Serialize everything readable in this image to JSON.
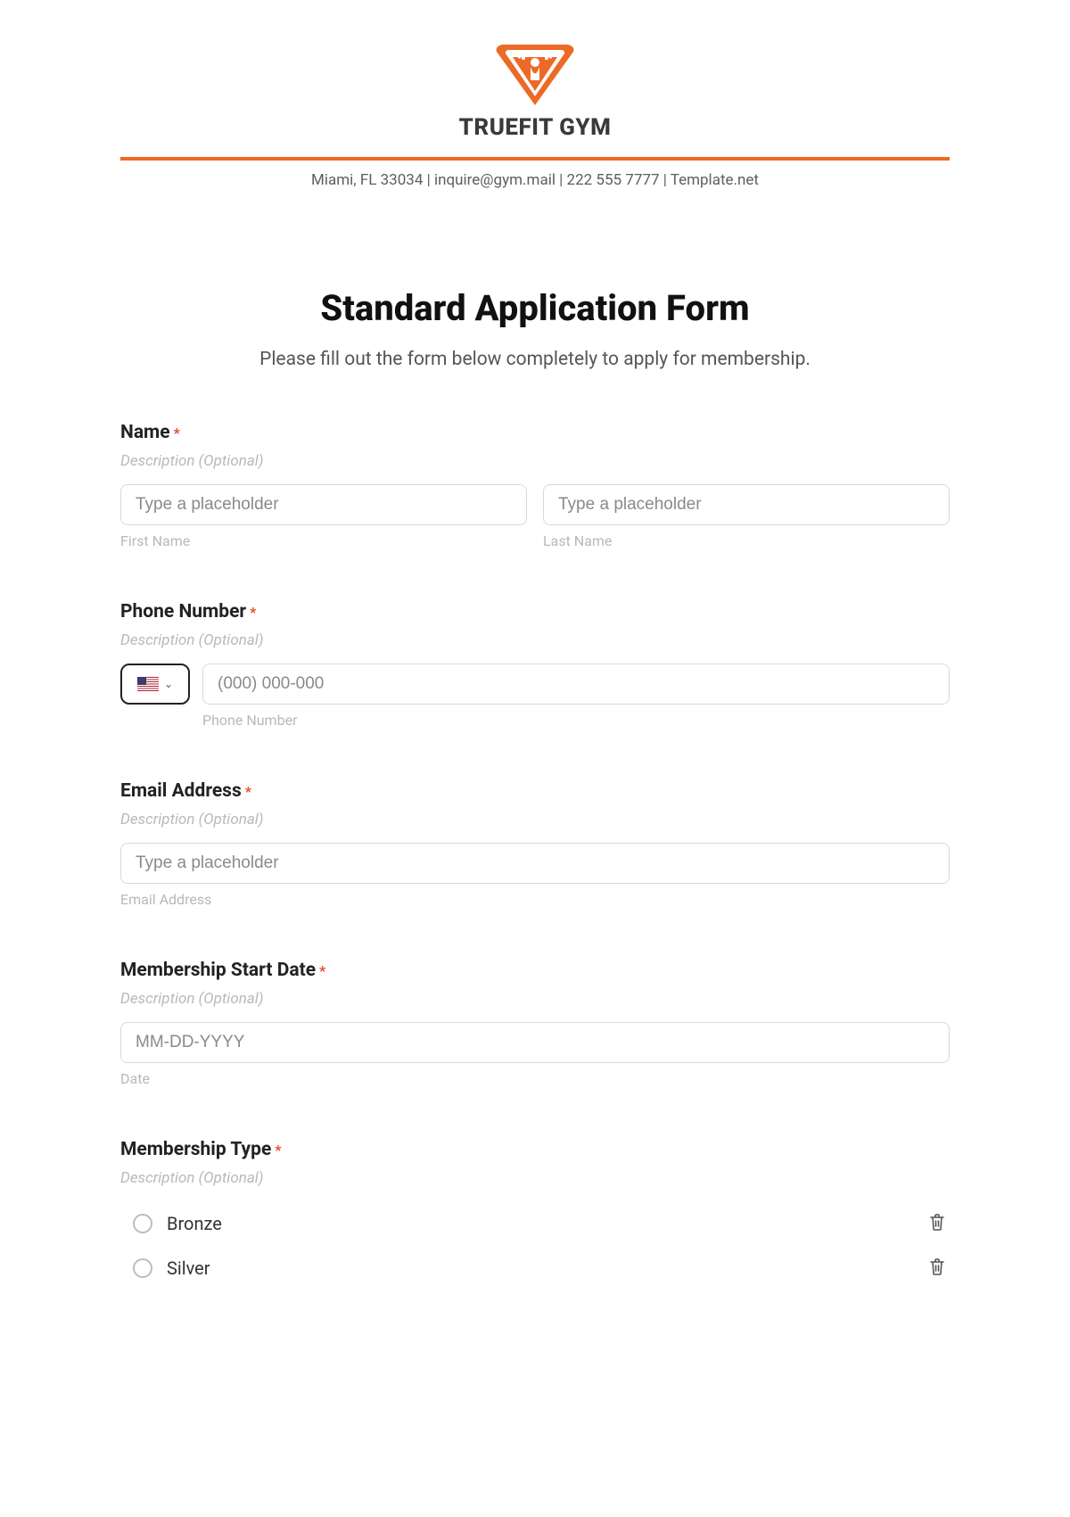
{
  "header": {
    "brand": "TRUEFIT GYM",
    "contact": "Miami, FL 33034 | inquire@gym.mail | 222 555 7777 | Template.net"
  },
  "page": {
    "title": "Standard Application Form",
    "subtitle": "Please fill out the form below completely to apply for membership."
  },
  "form": {
    "desc_placeholder": "Description (Optional)",
    "required_mark": "*",
    "name": {
      "label": "Name",
      "first_placeholder": "Type a placeholder",
      "first_sub": "First Name",
      "last_placeholder": "Type a placeholder",
      "last_sub": "Last Name"
    },
    "phone": {
      "label": "Phone Number",
      "placeholder": "(000) 000-000",
      "sub": "Phone Number"
    },
    "email": {
      "label": "Email Address",
      "placeholder": "Type a placeholder",
      "sub": "Email Address"
    },
    "start": {
      "label": "Membership Start Date",
      "placeholder": "MM-DD-YYYY",
      "sub": "Date"
    },
    "membership": {
      "label": "Membership Type",
      "options": [
        "Bronze",
        "Silver"
      ]
    }
  }
}
